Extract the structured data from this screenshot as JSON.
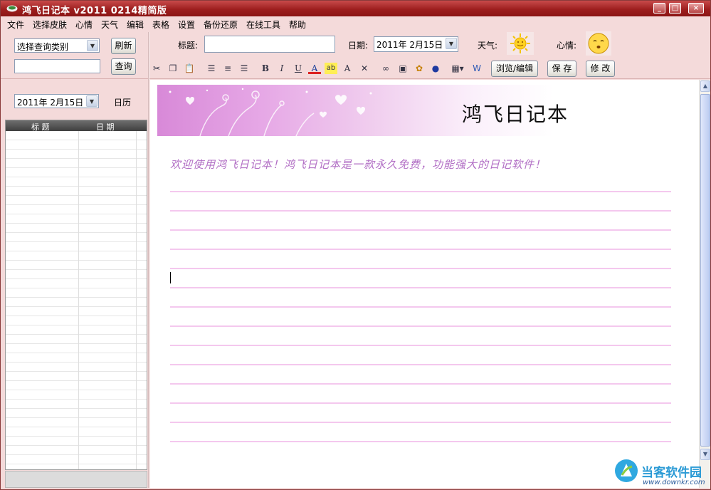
{
  "window": {
    "title": "鸿飞日记本 v2011 0214精简版",
    "min_label": "_",
    "max_label": "□",
    "close_label": "×"
  },
  "menu": [
    "文件",
    "选择皮肤",
    "心情",
    "天气",
    "编辑",
    "表格",
    "设置",
    "备份还原",
    "在线工具",
    "帮助"
  ],
  "search_panel": {
    "category_select": "选择查询类别",
    "refresh_button": "刷新",
    "query_input": "",
    "query_button": "查询",
    "date_select": "2011年  2月15日",
    "calendar_label": "日历"
  },
  "entry_form": {
    "title_label": "标题:",
    "title_value": "",
    "date_label": "日期:",
    "date_value": "2011年  2月15日",
    "weather_label": "天气:",
    "mood_label": "心情:",
    "weather_icon": "sun-icon",
    "mood_icon": "smiley-icon"
  },
  "format_toolbar": {
    "bold": "B",
    "italic": "I",
    "underline": "U",
    "font_color": "A",
    "highlight": "ab",
    "font_size": "A",
    "browse_edit_button": "浏览/编辑",
    "save_button": "保 存",
    "modify_button": "修 改"
  },
  "diary_list": {
    "columns": [
      "标 题",
      "日 期"
    ],
    "rows": []
  },
  "editor": {
    "banner_title": "鸿飞日记本",
    "welcome_text": "欢迎使用鸿飞日记本！鸿飞日记本是一款永久免费，功能强大的日记软件！"
  },
  "watermark": {
    "text": "当客软件园",
    "url": "www.downkr.com"
  },
  "colors": {
    "titlebar": "#9e1f1f",
    "panel_bg": "#f4dada",
    "welcome_text": "#b26fc5",
    "ruled_line": "#f4c8ee"
  }
}
